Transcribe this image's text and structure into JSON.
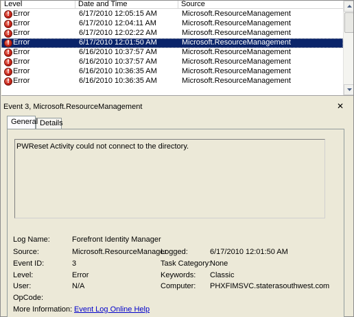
{
  "columns": {
    "level": "Level",
    "date": "Date and Time",
    "source": "Source"
  },
  "events": [
    {
      "level": "Error",
      "date": "6/17/2010 12:05:15 AM",
      "source": "Microsoft.ResourceManagement",
      "selected": false
    },
    {
      "level": "Error",
      "date": "6/17/2010 12:04:11 AM",
      "source": "Microsoft.ResourceManagement",
      "selected": false
    },
    {
      "level": "Error",
      "date": "6/17/2010 12:02:22 AM",
      "source": "Microsoft.ResourceManagement",
      "selected": false
    },
    {
      "level": "Error",
      "date": "6/17/2010 12:01:50 AM",
      "source": "Microsoft.ResourceManagement",
      "selected": true
    },
    {
      "level": "Error",
      "date": "6/16/2010 10:37:57 AM",
      "source": "Microsoft.ResourceManagement",
      "selected": false
    },
    {
      "level": "Error",
      "date": "6/16/2010 10:37:57 AM",
      "source": "Microsoft.ResourceManagement",
      "selected": false
    },
    {
      "level": "Error",
      "date": "6/16/2010 10:36:35 AM",
      "source": "Microsoft.ResourceManagement",
      "selected": false
    },
    {
      "level": "Error",
      "date": "6/16/2010 10:36:35 AM",
      "source": "Microsoft.ResourceManagement",
      "selected": false
    }
  ],
  "error_icon_glyph": "!",
  "detail": {
    "title": "Event 3, Microsoft.ResourceManagement",
    "close_glyph": "✕",
    "tabs": [
      "General",
      "Details"
    ],
    "active_tab": "General",
    "message": "PWReset Activity could not connect to the directory.",
    "labels": {
      "log_name": "Log Name:",
      "source": "Source:",
      "event_id": "Event ID:",
      "level": "Level:",
      "user": "User:",
      "opcode": "OpCode:",
      "more_info": "More Information:",
      "logged": "Logged:",
      "task_category": "Task Category:",
      "keywords": "Keywords:",
      "computer": "Computer:"
    },
    "values": {
      "log_name": "Forefront Identity Manager",
      "source": "Microsoft.ResourceManager",
      "event_id": "3",
      "level": "Error",
      "user": "N/A",
      "opcode": "",
      "more_info_link": "Event Log Online Help",
      "logged": "6/17/2010 12:01:50 AM",
      "task_category": "None",
      "keywords": "Classic",
      "computer": "PHXFIMSVC.staterasouthwest.com"
    }
  },
  "colors": {
    "selection": "#0a246a",
    "link": "#0000cc",
    "panel_bg": "#ece9d8"
  }
}
